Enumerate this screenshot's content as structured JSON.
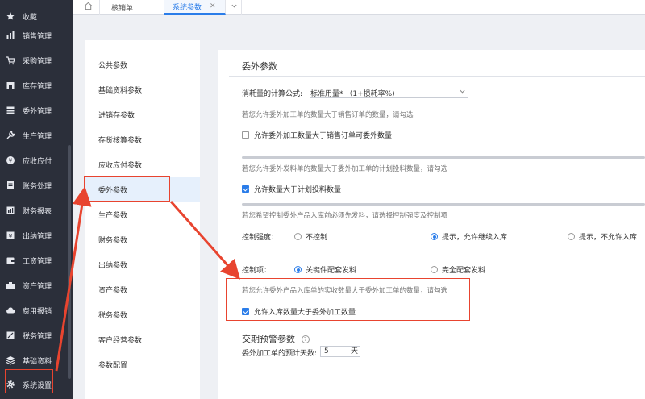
{
  "colors": {
    "accent": "#2b7de9",
    "annotation": "#e8442f",
    "nav_bg": "#2b2f3a"
  },
  "nav": {
    "items": [
      {
        "label": "收藏",
        "icon": "star-icon"
      },
      {
        "label": "销售管理",
        "icon": "bar-chart-icon"
      },
      {
        "label": "采购管理",
        "icon": "cart-icon"
      },
      {
        "label": "库存管理",
        "icon": "warehouse-icon"
      },
      {
        "label": "委外管理",
        "icon": "stack-icon"
      },
      {
        "label": "生产管理",
        "icon": "wrench-icon"
      },
      {
        "label": "应收应付",
        "icon": "coin-icon"
      },
      {
        "label": "账务处理",
        "icon": "ledger-icon"
      },
      {
        "label": "财务报表",
        "icon": "report-icon"
      },
      {
        "label": "出纳管理",
        "icon": "cashier-icon"
      },
      {
        "label": "工资管理",
        "icon": "wallet-icon"
      },
      {
        "label": "资产管理",
        "icon": "asset-icon"
      },
      {
        "label": "费用报销",
        "icon": "cloud-icon"
      },
      {
        "label": "税务管理",
        "icon": "tax-icon"
      },
      {
        "label": "基础资料",
        "icon": "layers-icon"
      },
      {
        "label": "系统设置",
        "icon": "gear-icon"
      }
    ]
  },
  "tabs": [
    {
      "label": "核销单"
    },
    {
      "label": "系统参数",
      "close": "✕"
    }
  ],
  "categories": [
    "公共参数",
    "基础资料参数",
    "进销存参数",
    "存货核算参数",
    "应收应付参数",
    "委外参数",
    "生产参数",
    "财务参数",
    "出纳参数",
    "资产参数",
    "税务参数",
    "客户经营参数",
    "参数配置"
  ],
  "main": {
    "section_title": "委外参数",
    "formula_label": "消耗量的计算公式:",
    "formula_value": "标准用量* （1+损耗率%)",
    "hint1": "若您允许委外加工单的数量大于销售订单的数量，请勾选",
    "check1": "允许委外加工数量大于销售订单可委外数量",
    "hint2": "若您允许委外发料单的数量大于委外加工单的计划投料数量，请勾选",
    "check2": "允许数量大于计划投料数量",
    "hint3": "若您希望控制委外产品入库前必须先发料，请选择控制强度及控制项",
    "strength_label": "控制强度：",
    "strength_options": [
      "不控制",
      "提示，允许继续入库",
      "提示，不允许入库"
    ],
    "item_label": "控制项：",
    "item_options": [
      "关键件配套发料",
      "完全配套发料"
    ],
    "hint4": "若您允许委外产品入库单的实收数量大于委外加工单的数量，请勾选",
    "check4": "允许入库数量大于委外加工数量",
    "warn_title": "交期预警参数",
    "warn_label": "委外加工单的预计天数:",
    "warn_days": "5",
    "warn_unit": "天"
  }
}
